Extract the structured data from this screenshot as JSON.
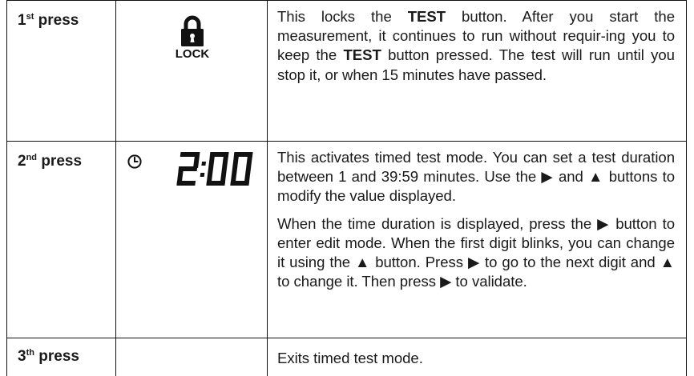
{
  "rows": [
    {
      "press_number": "1",
      "press_suffix": "st",
      "press_word": "press",
      "icon": "lock-icon",
      "icon_label": "LOCK",
      "desc": {
        "t1": "This locks the ",
        "b1": "TEST",
        "t2": " button. After you start the measurement, it continues to run without requir-ing you to keep the ",
        "b2": "TEST",
        "t3": " button pressed. The test will run until you stop it, or when 15 minutes have passed."
      }
    },
    {
      "press_number": "2",
      "press_suffix": "nd",
      "press_word": "press",
      "icon": "clock-icon",
      "display_value": "2:00",
      "p1": "This activates timed test mode. You can set a test duration between 1 and 39:59 minutes. Use the ▶ and ▲ buttons to modify the value displayed.",
      "p2": "When the time duration is displayed, press the ▶ button to enter edit mode. When the first digit blinks, you can change it using the ▲ button. Press ▶ to go to the next digit and ▲ to change it.  Then press ▶ to validate."
    },
    {
      "press_number": "3",
      "press_suffix": "th",
      "press_word": "press",
      "p1": "Exits timed test mode."
    }
  ]
}
